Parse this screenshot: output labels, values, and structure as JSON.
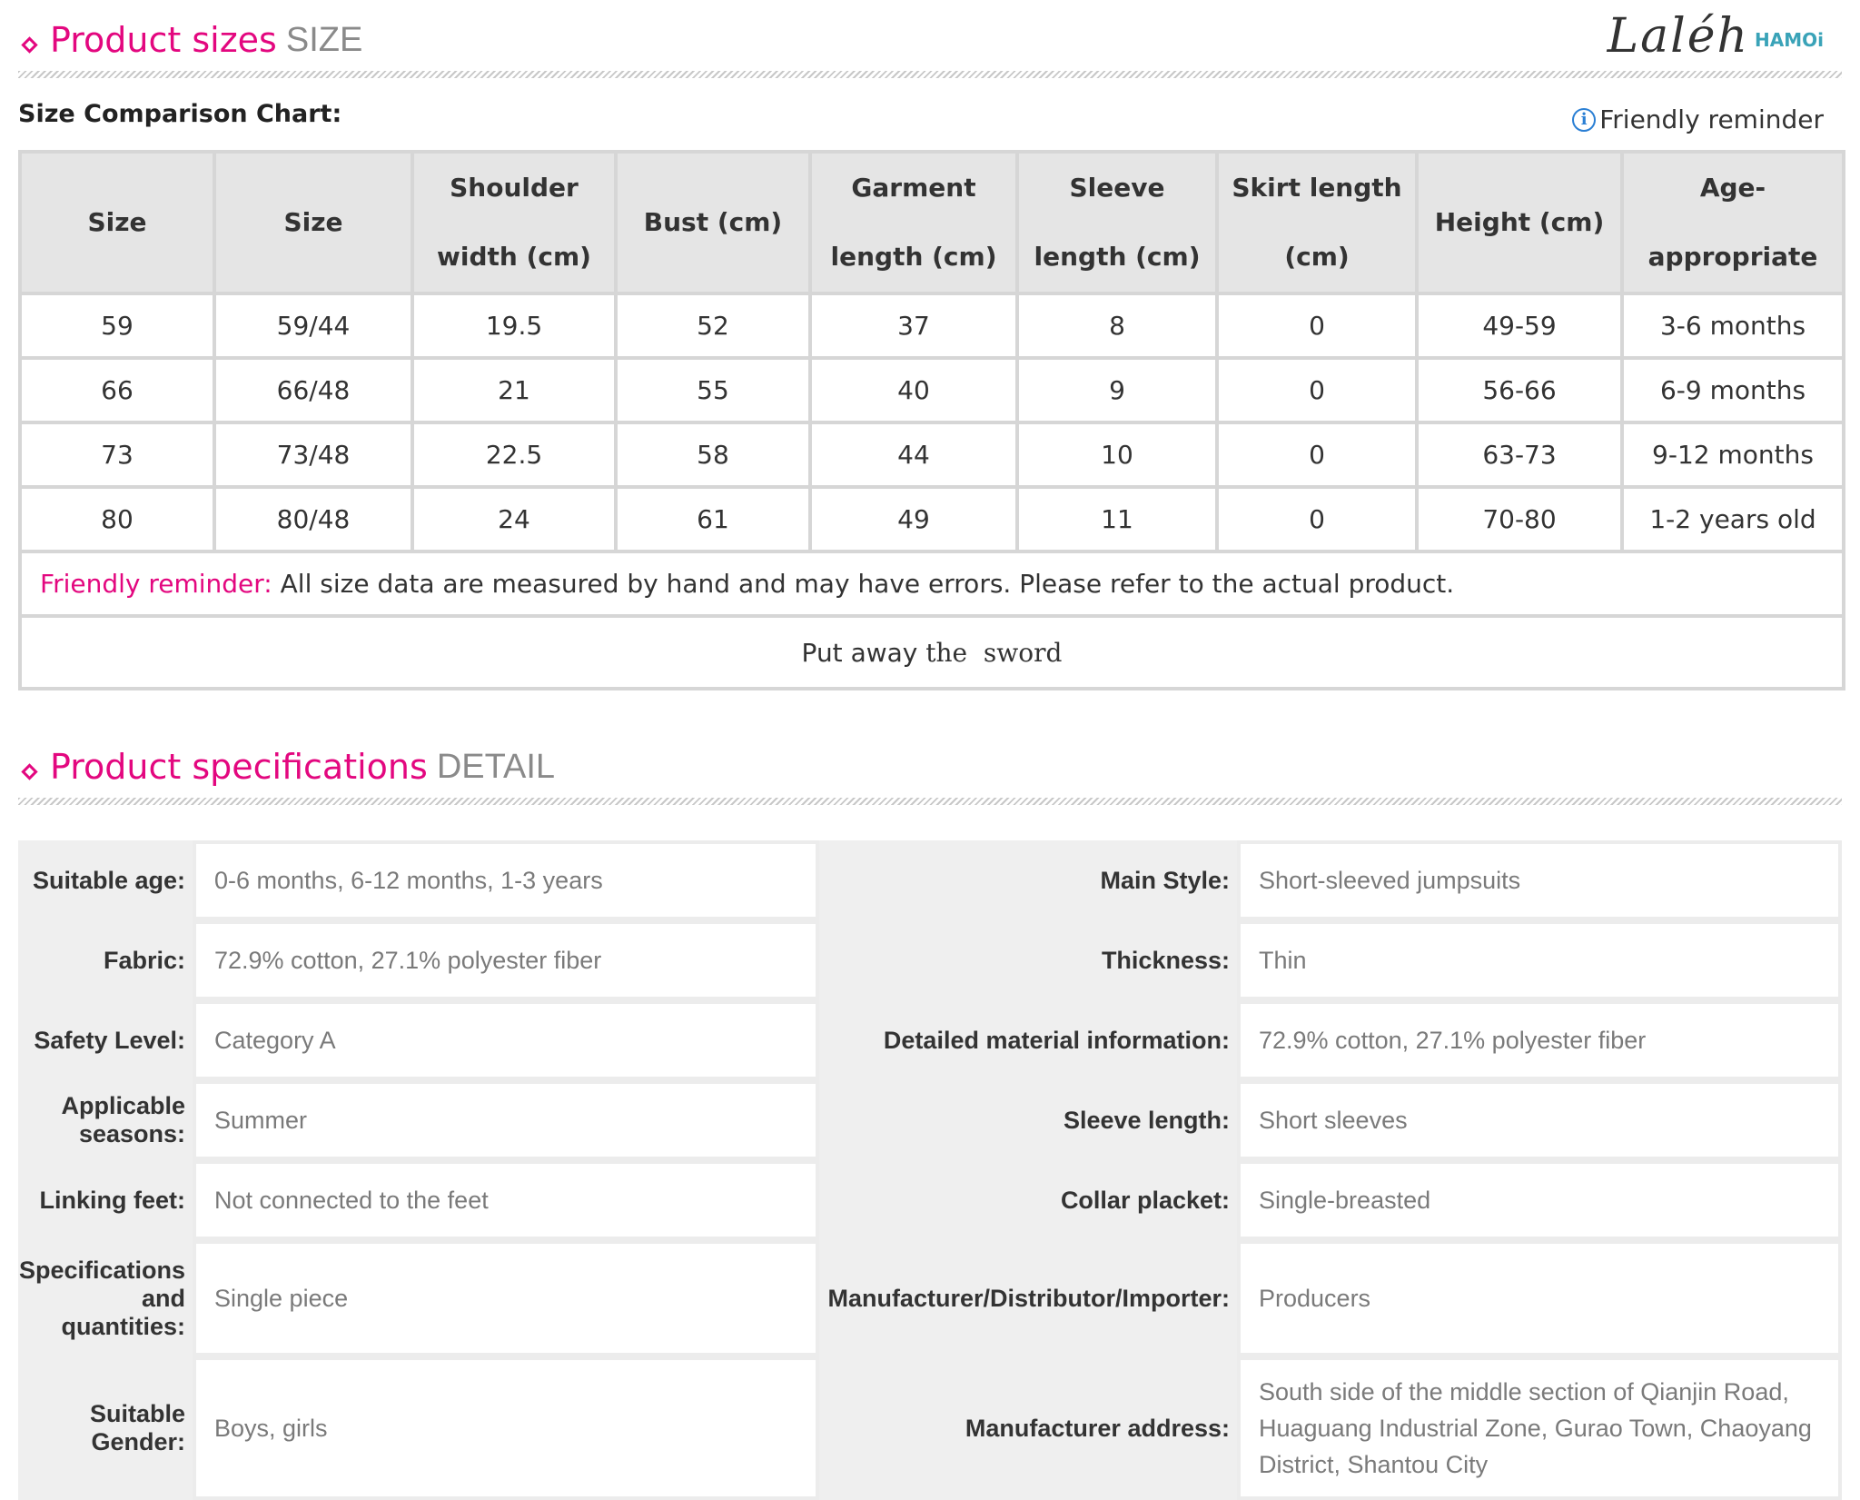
{
  "sizes_section": {
    "title": "Product sizes",
    "subtitle": "SIZE"
  },
  "brand": {
    "script": "Laléh",
    "hamoi": "HAMOi"
  },
  "chart_label": "Size Comparison Chart:",
  "friendly_reminder_link": "Friendly reminder",
  "size_table": {
    "headers": [
      "Size",
      "Size",
      "Shoulder width (cm)",
      "Bust (cm)",
      "Garment length (cm)",
      "Sleeve length (cm)",
      "Skirt length (cm)",
      "Height (cm)",
      "Age-appropriate"
    ],
    "rows": [
      [
        "59",
        "59/44",
        "19.5",
        "52",
        "37",
        "8",
        "0",
        "49-59",
        "3-6 months"
      ],
      [
        "66",
        "66/48",
        "21",
        "55",
        "40",
        "9",
        "0",
        "56-66",
        "6-9 months"
      ],
      [
        "73",
        "73/48",
        "22.5",
        "58",
        "44",
        "10",
        "0",
        "63-73",
        "9-12 months"
      ],
      [
        "80",
        "80/48",
        "24",
        "61",
        "49",
        "11",
        "0",
        "70-80",
        "1-2 years old"
      ]
    ],
    "note_label": "Friendly reminder:",
    "note_text": "All size data are measured by hand and may have errors. Please refer to the actual product.",
    "footer_a": "Put away",
    "footer_b": "the  sword"
  },
  "spec_section": {
    "title": "Product specifications",
    "subtitle": "DETAIL"
  },
  "specs": [
    {
      "k1": "Suitable age:",
      "v1": "0-6 months, 6-12 months, 1-3 years",
      "k2": "Main Style:",
      "v2": "Short-sleeved jumpsuits"
    },
    {
      "k1": "Fabric:",
      "v1": "72.9% cotton, 27.1% polyester fiber",
      "k2": "Thickness:",
      "v2": "Thin"
    },
    {
      "k1": "Safety Level:",
      "v1": "Category A",
      "k2": "Detailed material information:",
      "v2": "72.9% cotton, 27.1% polyester fiber"
    },
    {
      "k1": "Applicable seasons:",
      "v1": "Summer",
      "k2": "Sleeve length:",
      "v2": "Short sleeves"
    },
    {
      "k1": "Linking feet:",
      "v1": "Not connected to the feet",
      "k2": "Collar placket:",
      "v2": "Single-breasted"
    },
    {
      "k1": "Specifications and quantities:",
      "v1": "Single piece",
      "k2": "Manufacturer/Distributor/Importer:",
      "v2": "Producers"
    },
    {
      "k1": "Suitable Gender:",
      "v1": "Boys, girls",
      "k2": "Manufacturer address:",
      "v2": "South side of the middle section of Qianjin Road, Huaguang Industrial Zone, Gurao Town, Chaoyang District, Shantou City"
    }
  ]
}
